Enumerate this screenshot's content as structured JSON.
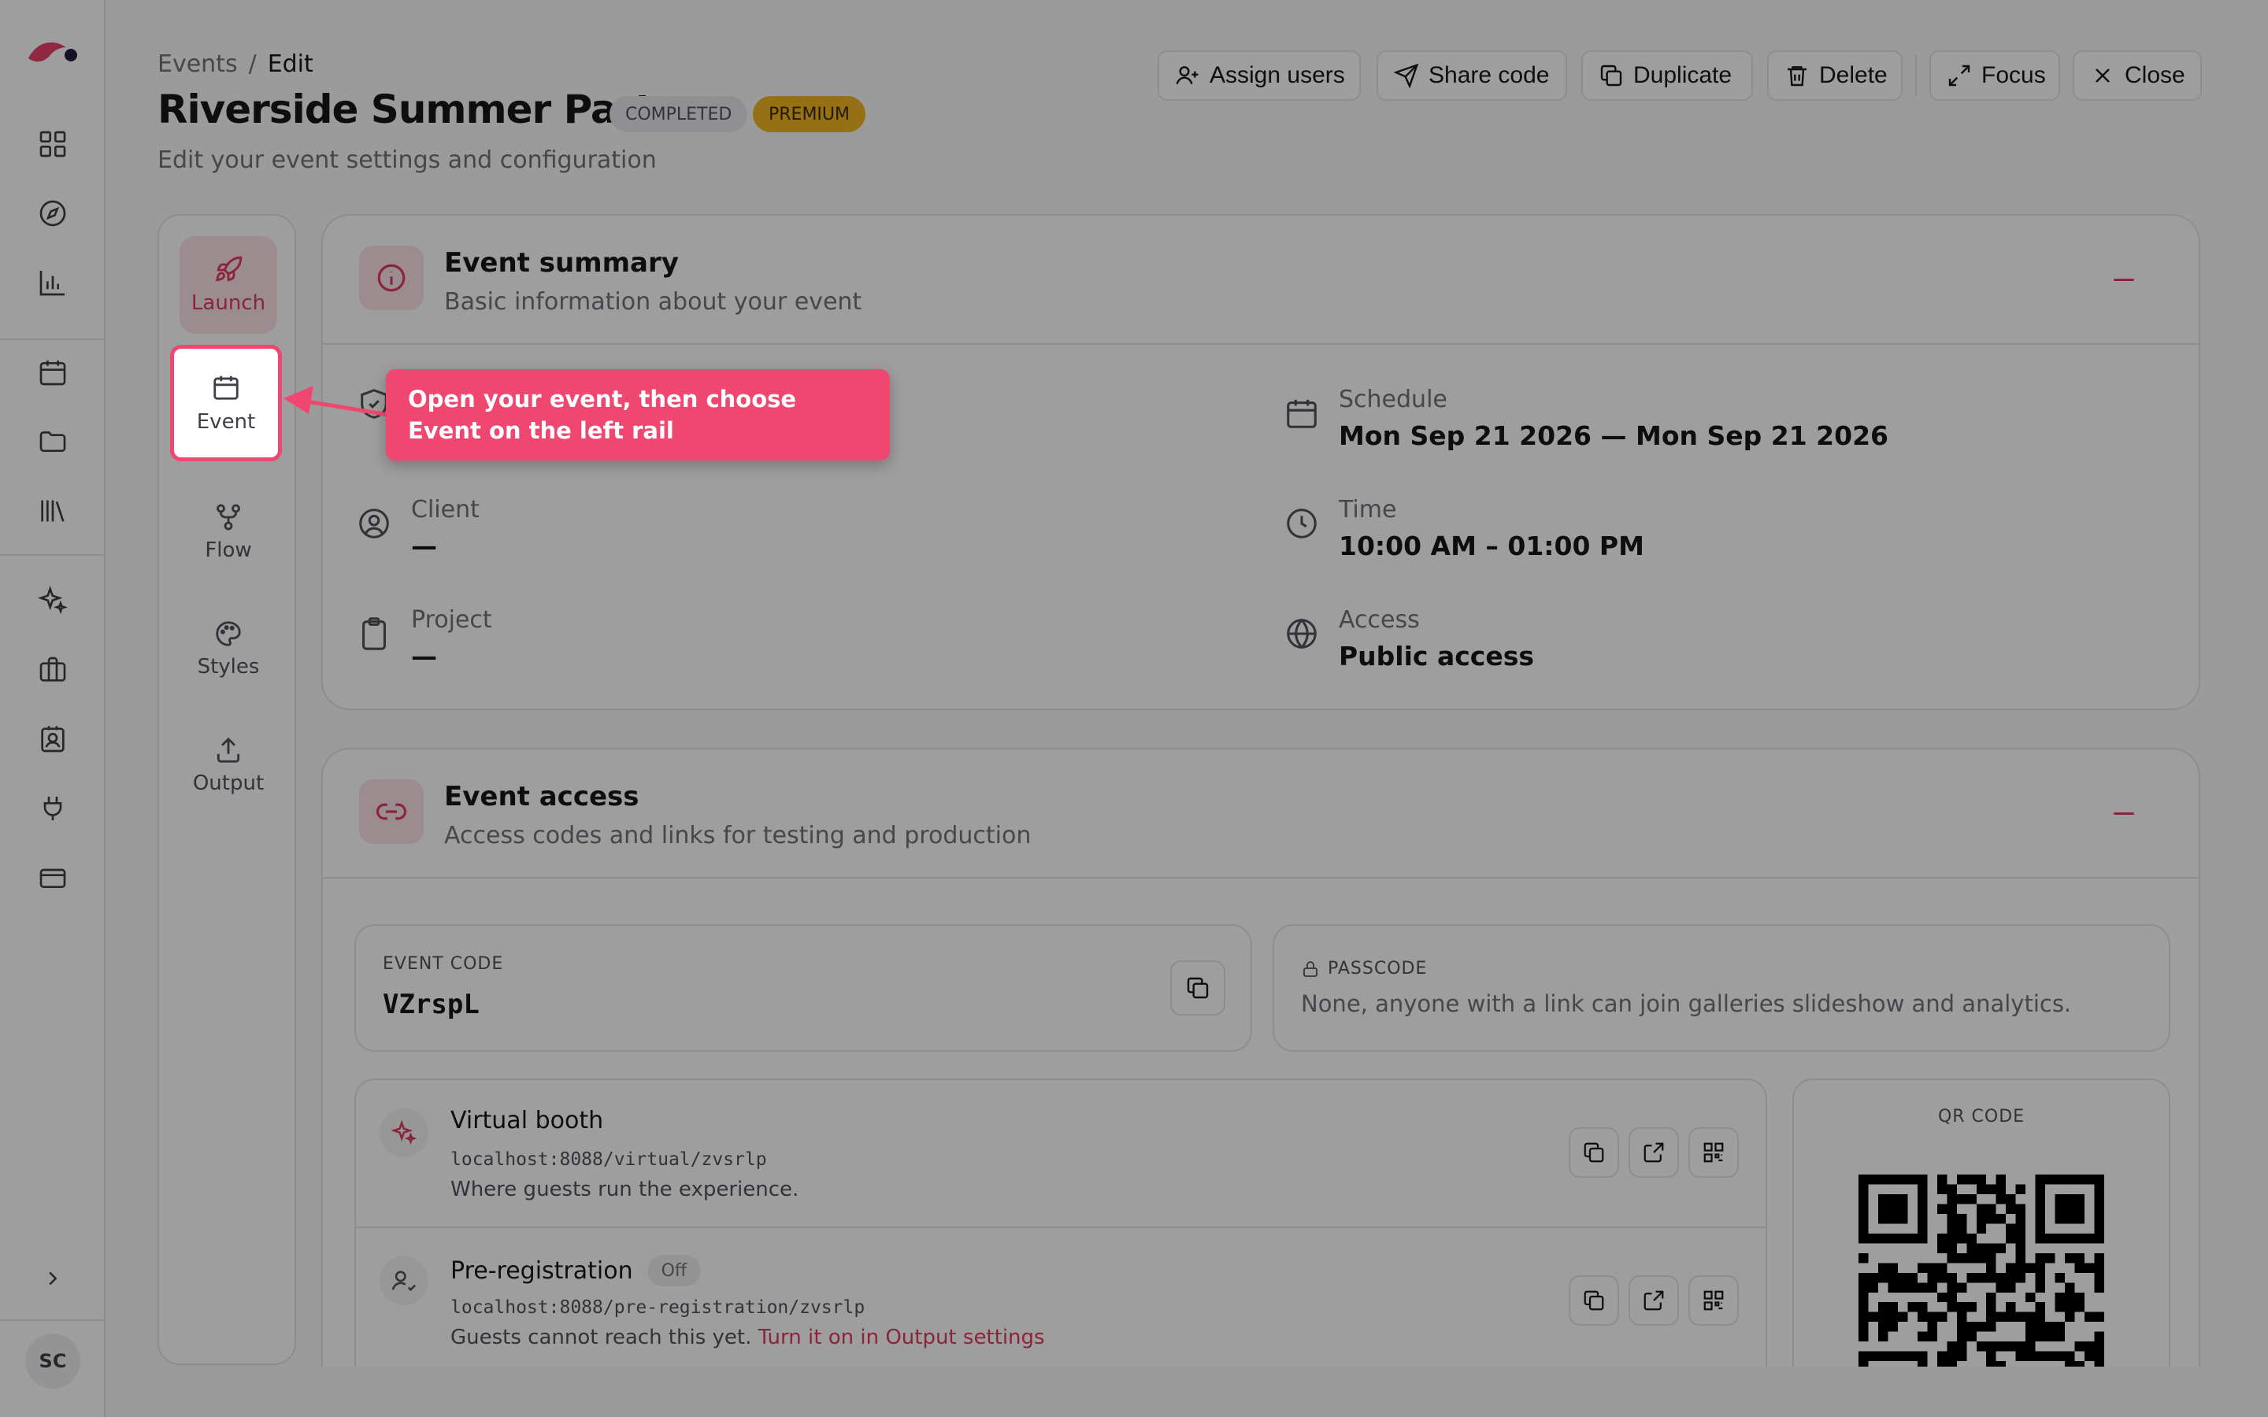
{
  "breadcrumb": {
    "root": "Events",
    "separator": "/",
    "current": "Edit"
  },
  "page": {
    "title": "Riverside Summer Party",
    "subtitle": "Edit your event settings and configuration",
    "badges": {
      "status": "COMPLETED",
      "tier": "PREMIUM"
    }
  },
  "toolbar": {
    "assign_users": "Assign users",
    "share_code": "Share code",
    "duplicate": "Duplicate",
    "delete": "Delete",
    "focus": "Focus",
    "close": "Close"
  },
  "user": {
    "initials": "SC"
  },
  "steps": {
    "launch": "Launch",
    "event": "Event",
    "flow": "Flow",
    "styles": "Styles",
    "output": "Output"
  },
  "summary": {
    "title": "Event summary",
    "subtitle": "Basic information about your event",
    "schedule_label": "Schedule",
    "schedule_value": "Mon Sep 21 2026 — Mon Sep 21 2026",
    "client_label": "Client",
    "client_value": "—",
    "time_label": "Time",
    "time_value": "10:00 AM – 01:00 PM",
    "project_label": "Project",
    "project_value": "—",
    "access_label": "Access",
    "access_value": "Public access"
  },
  "access": {
    "title": "Event access",
    "subtitle": "Access codes and links for testing and production",
    "event_code_label": "EVENT CODE",
    "event_code": "VZrspL",
    "passcode_label": "PASSCODE",
    "passcode_value": "None, anyone with a link can join galleries slideshow and analytics.",
    "qr_label": "QR CODE",
    "links": [
      {
        "title": "Virtual booth",
        "url": "localhost:8088/virtual/zvsrlp",
        "description": "Where guests run the experience."
      },
      {
        "title": "Pre-registration",
        "badge": "Off",
        "url": "localhost:8088/pre-registration/zvsrlp",
        "description": "Guests cannot reach this yet.",
        "action": "Turn it on in Output settings"
      }
    ]
  },
  "tour": {
    "callout": "Open your event, then choose Event on the left rail"
  },
  "colors": {
    "accent": "#ef4770",
    "accent_soft": "#fbe2e7",
    "premium": "#f2b521"
  }
}
